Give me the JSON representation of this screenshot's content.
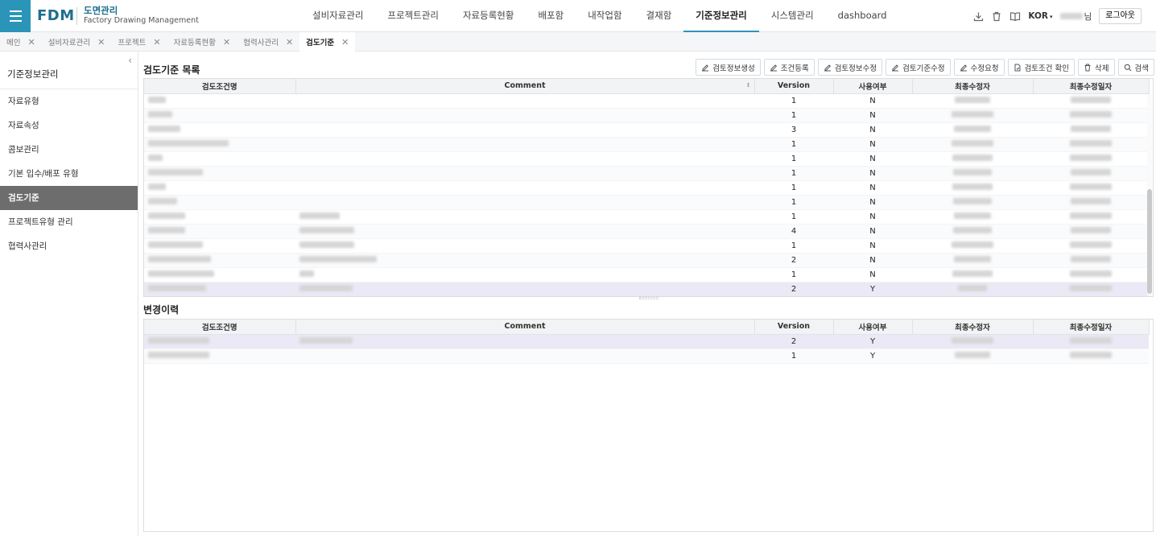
{
  "header": {
    "logo": "FDM",
    "subtitle_main": "도면관리",
    "subtitle_sub": "Factory Drawing Management",
    "menu": [
      "설비자료관리",
      "프로젝트관리",
      "자료등록현황",
      "배포함",
      "내작업함",
      "결재함",
      "기준정보관리",
      "시스템관리",
      "dashboard"
    ],
    "active_menu_index": 6,
    "lang": "KOR",
    "user_suffix": "님",
    "logout": "로그아웃",
    "icons": [
      "download-icon",
      "trash-icon",
      "book-icon"
    ]
  },
  "tabs": [
    {
      "label": "메인",
      "active": false
    },
    {
      "label": "설비자료관리",
      "active": false
    },
    {
      "label": "프로젝트",
      "active": false
    },
    {
      "label": "자료등록현황",
      "active": false
    },
    {
      "label": "협력사관리",
      "active": false
    },
    {
      "label": "검도기준",
      "active": true
    }
  ],
  "sidebar": {
    "title": "기준정보관리",
    "items": [
      "자료유형",
      "자료속성",
      "콤보관리",
      "기본 입수/배포 유형",
      "검도기준",
      "프로젝트유형 관리",
      "협력사관리"
    ],
    "active_index": 4
  },
  "list_section": {
    "title": "검도기준 목록",
    "buttons": [
      "검토정보생성",
      "조건등록",
      "검토정보수정",
      "검토기준수정",
      "수정요청",
      "검토조건 확인",
      "삭제",
      "검색"
    ],
    "columns": [
      "검도조건명",
      "Comment",
      "Version",
      "사용여부",
      "최종수정자",
      "최종수정일자"
    ],
    "rows": [
      {
        "version": "1",
        "use": "N"
      },
      {
        "version": "1",
        "use": "N"
      },
      {
        "version": "3",
        "use": "N"
      },
      {
        "version": "1",
        "use": "N"
      },
      {
        "version": "1",
        "use": "N"
      },
      {
        "version": "1",
        "use": "N"
      },
      {
        "version": "1",
        "use": "N"
      },
      {
        "version": "1",
        "use": "N"
      },
      {
        "version": "1",
        "use": "N"
      },
      {
        "version": "4",
        "use": "N"
      },
      {
        "version": "1",
        "use": "N"
      },
      {
        "version": "2",
        "use": "N"
      },
      {
        "version": "1",
        "use": "N"
      },
      {
        "version": "2",
        "use": "Y"
      }
    ]
  },
  "history_section": {
    "title": "변경이력",
    "columns": [
      "검도조건명",
      "Comment",
      "Version",
      "사용여부",
      "최종수정자",
      "최종수정일자"
    ],
    "rows": [
      {
        "version": "2",
        "use": "Y"
      },
      {
        "version": "1",
        "use": "Y"
      }
    ]
  },
  "colors": {
    "accent": "#2b95b9",
    "sidebar_active": "#6d6d6d",
    "row_selected": "#ebe9f5"
  }
}
